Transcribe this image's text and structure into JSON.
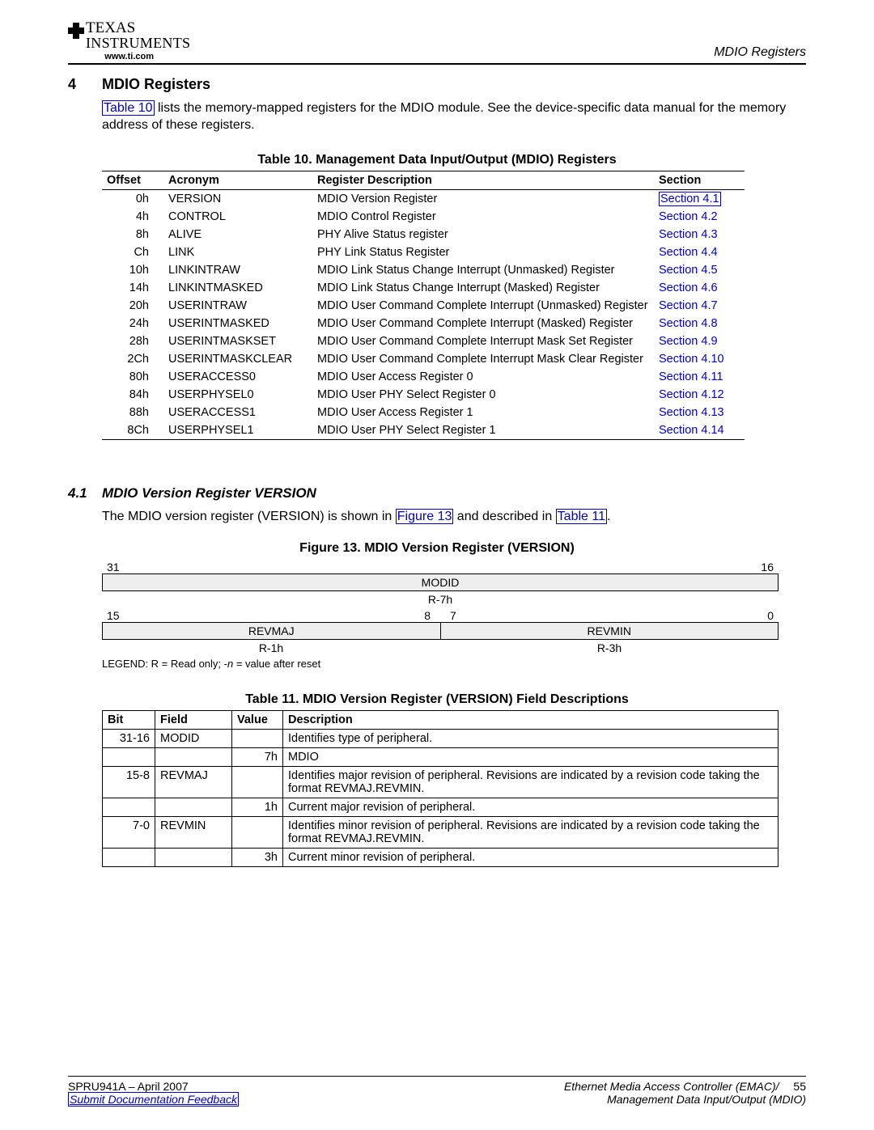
{
  "header": {
    "ti_line1": "TEXAS",
    "ti_line2": "INSTRUMENTS",
    "url": "www.ti.com",
    "right": "MDIO Registers"
  },
  "section": {
    "num": "4",
    "title": "MDIO Registers",
    "para_before": "",
    "para": "lists the memory-mapped registers for the MDIO module. See the device-specific data manual for the memory address of these registers.",
    "link_text": "Table 10"
  },
  "table10": {
    "caption": "Table 10. Management Data Input/Output (MDIO) Registers",
    "headers": [
      "Offset",
      "Acronym",
      "Register Description",
      "Section"
    ],
    "rows": [
      {
        "offset": "0h",
        "acr": "VERSION",
        "desc": "MDIO Version Register",
        "sec": "Section 4.1",
        "boxed": true
      },
      {
        "offset": "4h",
        "acr": "CONTROL",
        "desc": "MDIO Control Register",
        "sec": "Section 4.2"
      },
      {
        "offset": "8h",
        "acr": "ALIVE",
        "desc": "PHY Alive Status register",
        "sec": "Section 4.3"
      },
      {
        "offset": "Ch",
        "acr": "LINK",
        "desc": "PHY Link Status Register",
        "sec": "Section 4.4"
      },
      {
        "offset": "10h",
        "acr": "LINKINTRAW",
        "desc": "MDIO Link Status Change Interrupt (Unmasked) Register",
        "sec": "Section 4.5"
      },
      {
        "offset": "14h",
        "acr": "LINKINTMASKED",
        "desc": "MDIO Link Status Change Interrupt (Masked) Register",
        "sec": "Section 4.6"
      },
      {
        "offset": "20h",
        "acr": "USERINTRAW",
        "desc": "MDIO User Command Complete Interrupt (Unmasked) Register",
        "sec": "Section 4.7"
      },
      {
        "offset": "24h",
        "acr": "USERINTMASKED",
        "desc": "MDIO User Command Complete Interrupt (Masked) Register",
        "sec": "Section 4.8"
      },
      {
        "offset": "28h",
        "acr": "USERINTMASKSET",
        "desc": "MDIO User Command Complete Interrupt Mask Set Register",
        "sec": "Section 4.9"
      },
      {
        "offset": "2Ch",
        "acr": "USERINTMASKCLEAR",
        "desc": "MDIO User Command Complete Interrupt Mask Clear Register",
        "sec": "Section 4.10"
      },
      {
        "offset": "80h",
        "acr": "USERACCESS0",
        "desc": "MDIO User Access Register 0",
        "sec": "Section 4.11"
      },
      {
        "offset": "84h",
        "acr": "USERPHYSEL0",
        "desc": "MDIO User PHY Select Register 0",
        "sec": "Section 4.12"
      },
      {
        "offset": "88h",
        "acr": "USERACCESS1",
        "desc": "MDIO User Access Register 1",
        "sec": "Section 4.13"
      },
      {
        "offset": "8Ch",
        "acr": "USERPHYSEL1",
        "desc": "MDIO User PHY Select Register 1",
        "sec": "Section 4.14"
      }
    ]
  },
  "section41": {
    "num": "4.1",
    "title": "MDIO Version Register VERSION",
    "para_pre": "The MDIO version register (VERSION) is shown in ",
    "fig_link": "Figure 13",
    "para_mid": " and described in ",
    "tbl_link": "Table 11",
    "para_post": "."
  },
  "figure13": {
    "caption": "Figure 13. MDIO Version Register (VERSION)",
    "bits_top_left": "31",
    "bits_top_right": "16",
    "field_top": "MODID",
    "reset_top": "R-7h",
    "bits_bot": [
      "15",
      "8",
      "7",
      "0"
    ],
    "field_bot_left": "REVMAJ",
    "field_bot_right": "REVMIN",
    "reset_bot_left": "R-1h",
    "reset_bot_right": "R-3h",
    "legend": "LEGEND: R = Read only; -n = value after reset"
  },
  "table11": {
    "caption": "Table 11. MDIO Version Register (VERSION) Field Descriptions",
    "headers": [
      "Bit",
      "Field",
      "Value",
      "Description"
    ],
    "rows": [
      {
        "bit": "31-16",
        "field": "MODID",
        "value": "",
        "desc": "Identifies type of peripheral."
      },
      {
        "bit": "",
        "field": "",
        "value": "7h",
        "desc": "MDIO"
      },
      {
        "bit": "15-8",
        "field": "REVMAJ",
        "value": "",
        "desc": "Identifies major revision of peripheral. Revisions are indicated by a revision code taking the format REVMAJ.REVMIN."
      },
      {
        "bit": "",
        "field": "",
        "value": "1h",
        "desc": "Current major revision of peripheral."
      },
      {
        "bit": "7-0",
        "field": "REVMIN",
        "value": "",
        "desc": "Identifies minor revision of peripheral. Revisions are indicated by a revision code taking the format REVMAJ.REVMIN."
      },
      {
        "bit": "",
        "field": "",
        "value": "3h",
        "desc": "Current minor revision of peripheral."
      }
    ]
  },
  "footer": {
    "doc_id": "SPRU941A – April 2007",
    "feedback": "Submit Documentation Feedback",
    "right_line1": "Ethernet Media Access Controller (EMAC)/",
    "right_line2": "Management Data Input/Output (MDIO)",
    "page": "55"
  },
  "n_italic": "n"
}
